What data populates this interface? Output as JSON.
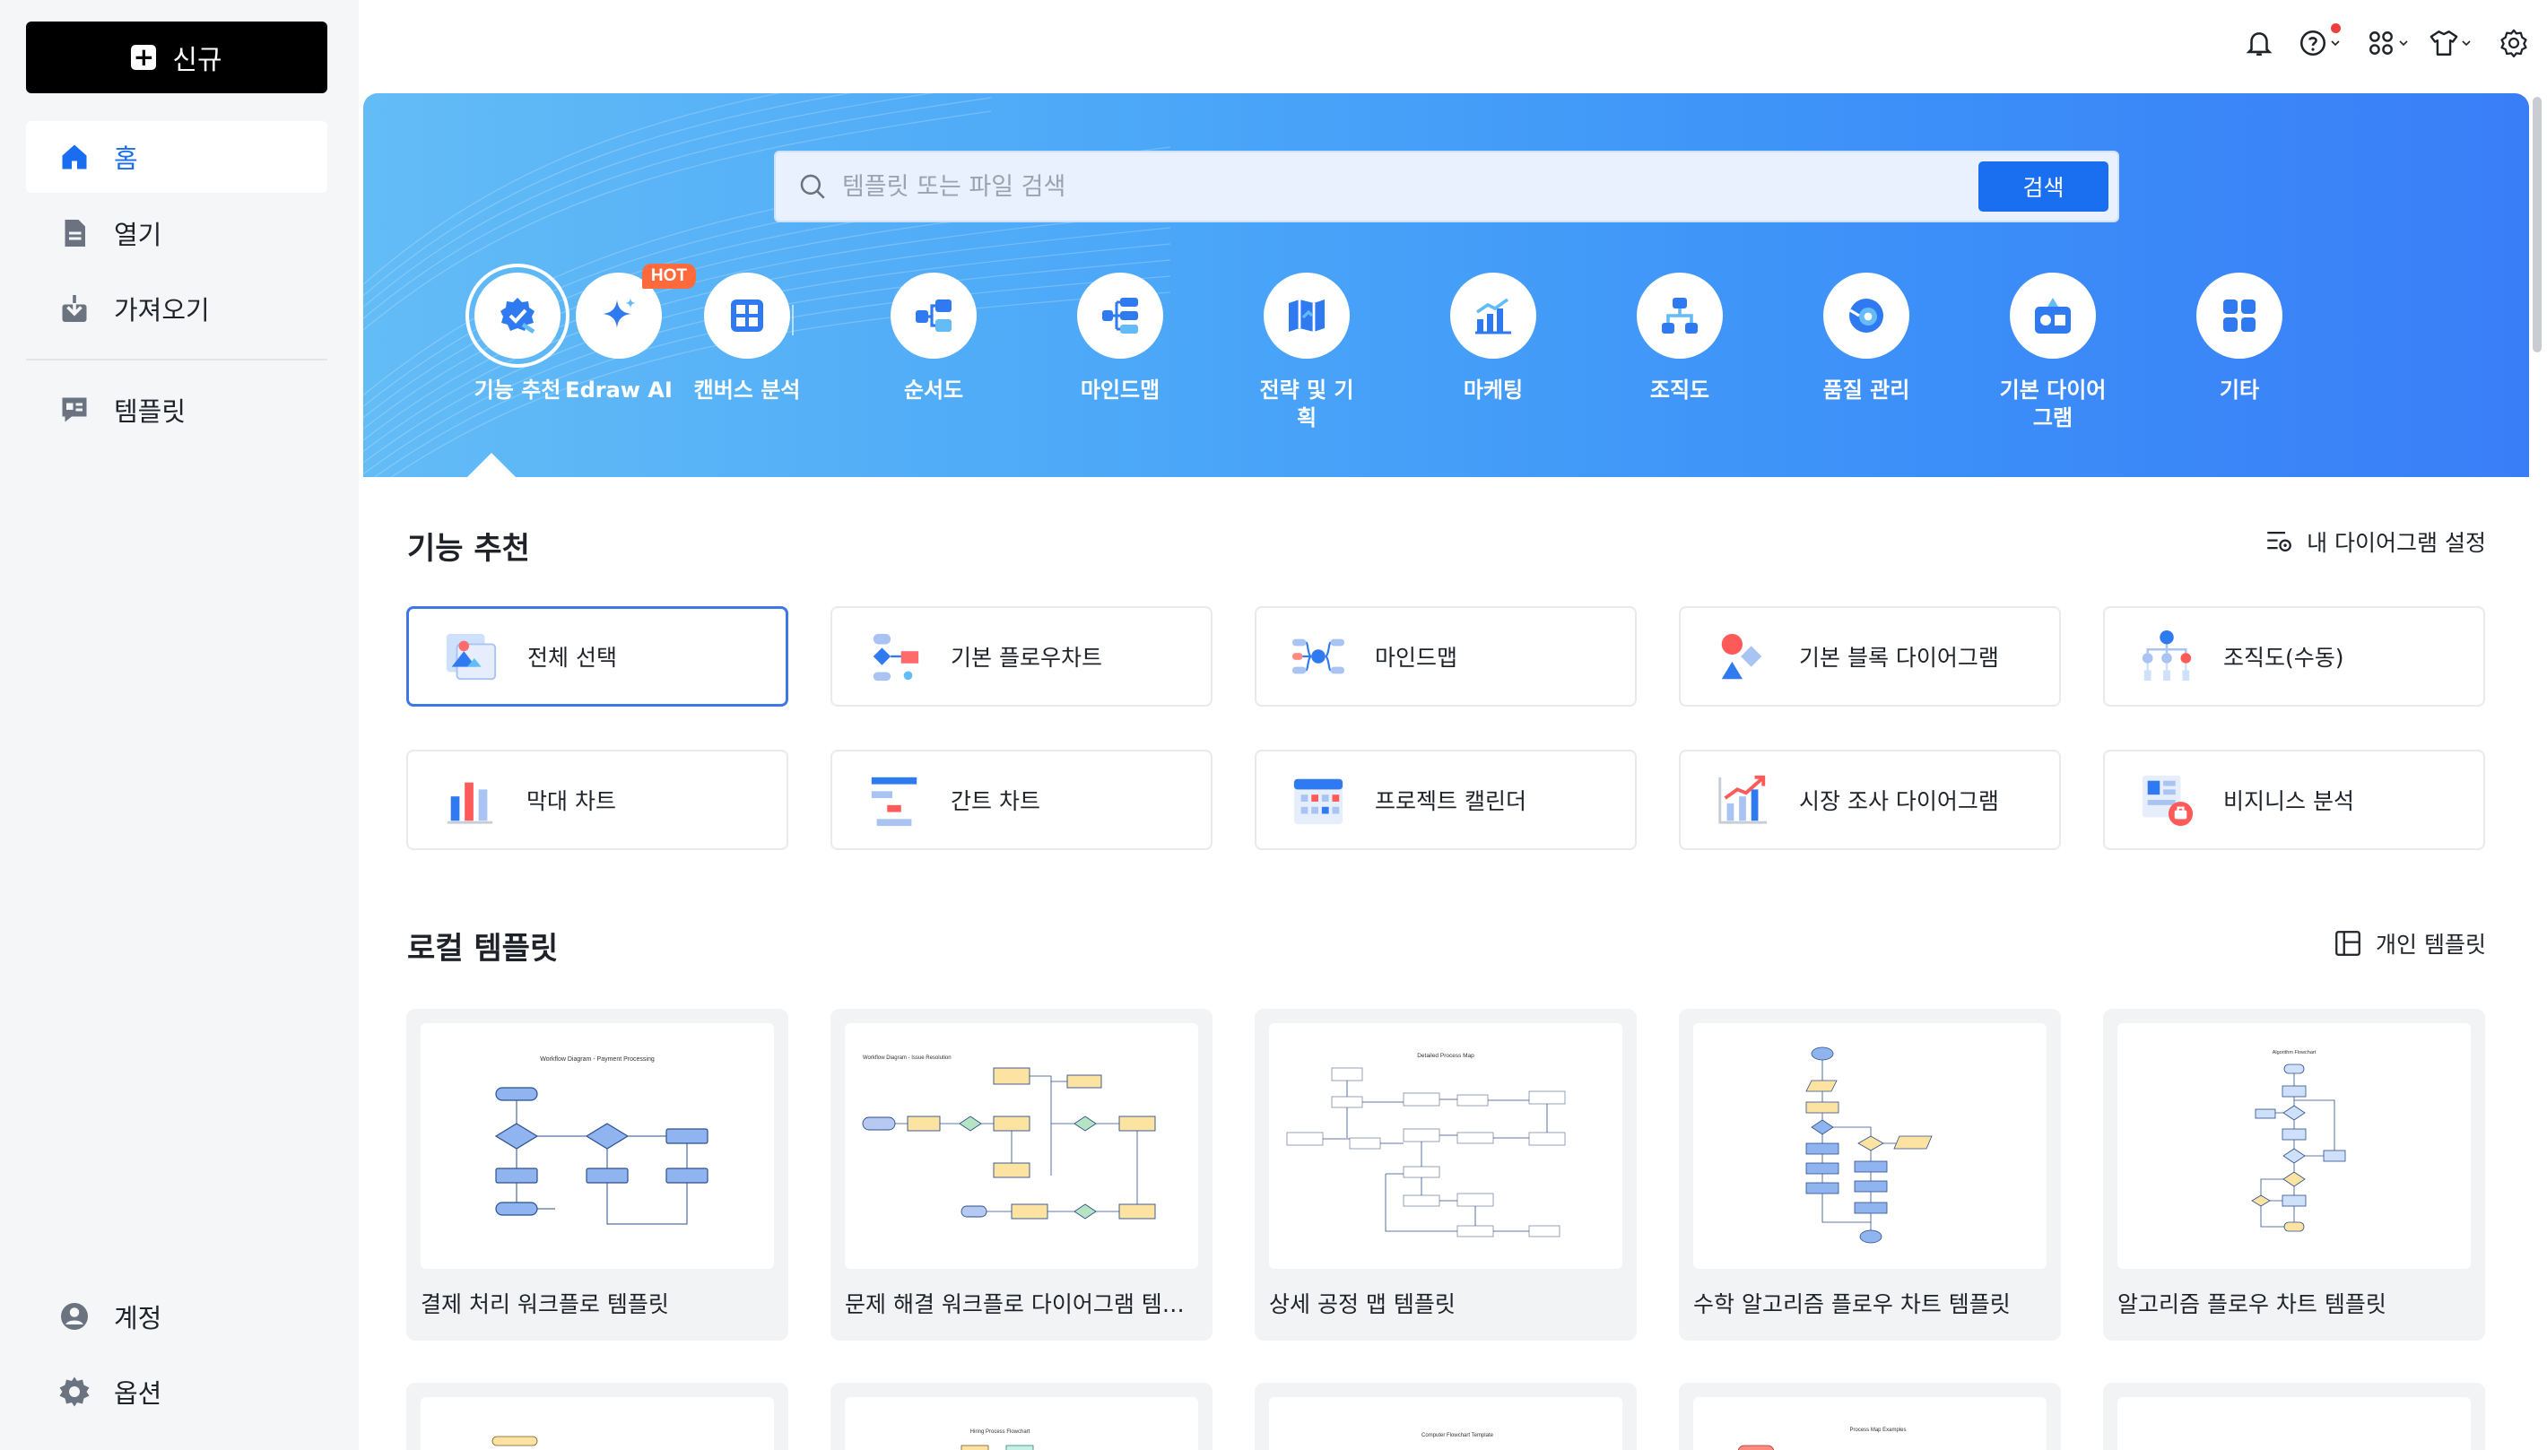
{
  "sidebar": {
    "new_label": "신규",
    "items": [
      {
        "label": "홈"
      },
      {
        "label": "열기"
      },
      {
        "label": "가져오기"
      },
      {
        "label": "템플릿"
      }
    ],
    "bottom_items": [
      {
        "label": "계정"
      },
      {
        "label": "옵션"
      }
    ]
  },
  "topbar": {
    "icons": [
      "bell-icon",
      "help-icon",
      "apps-icon",
      "shirt-icon",
      "settings-icon"
    ]
  },
  "hero": {
    "search_placeholder": "템플릿 또는 파일 검색",
    "search_button": "검색",
    "hot_badge": "HOT",
    "categories": [
      {
        "label": "기능 추천",
        "icon": "star-badge-icon"
      },
      {
        "label": "Edraw AI",
        "icon": "sparkle-icon"
      },
      {
        "label": "캔버스 분석",
        "icon": "canvas-icon"
      },
      {
        "label": "순서도",
        "icon": "flowchart-icon"
      },
      {
        "label": "마인드맵",
        "icon": "mindmap-icon"
      },
      {
        "label": "전략 및 기획",
        "icon": "map-icon"
      },
      {
        "label": "마케팅",
        "icon": "chart-up-icon"
      },
      {
        "label": "조직도",
        "icon": "org-chart-icon"
      },
      {
        "label": "품질 관리",
        "icon": "quality-icon"
      },
      {
        "label": "기본 다이어그램",
        "icon": "shapes-icon"
      },
      {
        "label": "기타",
        "icon": "grid-icon"
      }
    ]
  },
  "features": {
    "title": "기능 추천",
    "link": "내 다이어그램 설정",
    "items": [
      {
        "label": "전체 선택"
      },
      {
        "label": "기본  플로우차트"
      },
      {
        "label": "마인드맵"
      },
      {
        "label": "기본 블록 다이어그램"
      },
      {
        "label": "조직도(수동)"
      },
      {
        "label": "막대 차트"
      },
      {
        "label": "간트 차트"
      },
      {
        "label": "프로젝트 캘린더"
      },
      {
        "label": "시장 조사 다이어그램"
      },
      {
        "label": "비지니스 분석"
      }
    ]
  },
  "local_templates": {
    "title": "로컬 템플릿",
    "link": "개인 템플릿",
    "items": [
      {
        "name": "결제 처리 워크플로 템플릿",
        "thumb_title": "Workflow Diagram - Payment Processing"
      },
      {
        "name": "문제 해결 워크플로 다이어그램 템플릿",
        "thumb_title": "Workflow Diagram - Issue Resolution"
      },
      {
        "name": "상세 공정 맵 템플릿",
        "thumb_title": "Detailed Process Map"
      },
      {
        "name": "수학 알고리즘 플로우 차트 템플릿",
        "thumb_title": ""
      },
      {
        "name": "알고리즘 플로우 차트 템플릿",
        "thumb_title": "Algorithm Flowchart"
      }
    ],
    "partial_items": [
      {
        "thumb_title": ""
      },
      {
        "thumb_title": "Hiring Process Flowchart"
      },
      {
        "thumb_title": "Computer Flowchart Template"
      },
      {
        "thumb_title": "Process Map Examples"
      },
      {
        "thumb_title": ""
      }
    ]
  }
}
